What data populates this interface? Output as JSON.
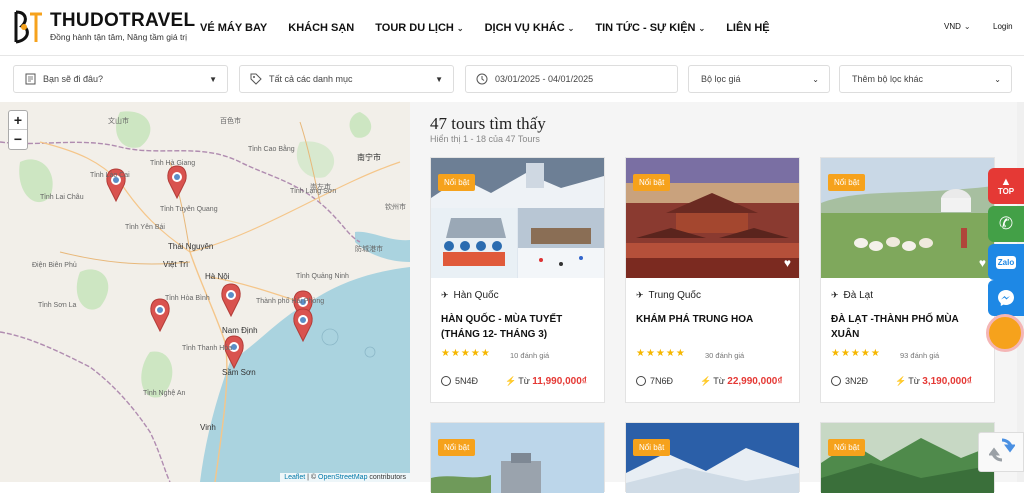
{
  "header": {
    "logo_name": "THUDOTRAVEL",
    "logo_slogan": "Đồng hành tận tâm, Nâng tầm giá trị",
    "nav": [
      {
        "label": "VÉ MÁY BAY",
        "dropdown": false
      },
      {
        "label": "KHÁCH SẠN",
        "dropdown": false
      },
      {
        "label": "TOUR DU LỊCH",
        "dropdown": true
      },
      {
        "label": "DỊCH VỤ KHÁC",
        "dropdown": true
      },
      {
        "label": "TIN TỨC - SỰ KIỆN",
        "dropdown": true
      },
      {
        "label": "LIÊN HỆ",
        "dropdown": false
      }
    ],
    "currency": "VND",
    "login": "Login"
  },
  "filters": {
    "destination_placeholder": "Bạn sẽ đi đâu?",
    "category_placeholder": "Tất cả các danh mục",
    "date_range": "03/01/2025 - 04/01/2025",
    "price_filter": "Bộ lọc giá",
    "more_filters": "Thêm bộ lọc khác"
  },
  "map": {
    "zoom_in": "+",
    "zoom_out": "−",
    "attribution_leaflet": "Leaflet",
    "attribution_sep": " | © ",
    "attribution_osm": "OpenStreetMap",
    "attribution_tail": " contributors",
    "labels": [
      "Tỉnh Hà Giang",
      "Tỉnh Lai Châu",
      "Tỉnh Tuyên Quang",
      "Thái Nguyên",
      "Việt Trì",
      "Hà Nội",
      "Tỉnh Hòa Bình",
      "Nam Định",
      "Thành phố Hải Phòng",
      "Tỉnh Thanh Hóa",
      "Sầm Sơn",
      "Tỉnh Nghệ An",
      "Vinh",
      "Điện Biên Phủ",
      "Tỉnh Sơn La",
      "Tỉnh Lào Cai",
      "Tỉnh Yên Bái",
      "Tỉnh Cao Bằng",
      "Tỉnh Lạng Sơn",
      "Tỉnh Quảng Ninh",
      "防城港市",
      "南宁市",
      "百色市",
      "文山市",
      "崇左市",
      "钦州市"
    ]
  },
  "results": {
    "title": "47 tours tìm thấy",
    "subtitle": "Hiển thị 1 - 18 của 47 Tours"
  },
  "tours": [
    {
      "badge": "Nổi bật",
      "destination": "Hàn Quốc",
      "name": "HÀN QUỐC - MÙA TUYẾT (THÁNG 12- THÁNG 3)",
      "rating": 5,
      "reviews": "10 đánh giá",
      "duration": "5N4Đ",
      "price_prefix": "Từ",
      "price": "11,990,000₫"
    },
    {
      "badge": "Nổi bật",
      "destination": "Trung Quốc",
      "name": "KHÁM PHÁ TRUNG HOA",
      "rating": 5,
      "reviews": "30 đánh giá",
      "duration": "7N6Đ",
      "price_prefix": "Từ",
      "price": "22,990,000₫"
    },
    {
      "badge": "Nổi bật",
      "destination": "Đà Lạt",
      "name": "ĐÀ LẠT -THÀNH PHỐ MÙA XUÂN",
      "rating": 5,
      "reviews": "93 đánh giá",
      "duration": "3N2Đ",
      "price_prefix": "Từ",
      "price": "3,190,000₫"
    },
    {
      "badge": "Nổi bật"
    },
    {
      "badge": "Nổi bật"
    },
    {
      "badge": "Nổi bật"
    }
  ],
  "floating": {
    "top_label": "TOP",
    "zalo_label": "Zalo"
  },
  "colors": {
    "accent_orange": "#f6a21c",
    "price_red": "#e53935",
    "star_yellow": "#f6b700",
    "marker_red": "#d9534f"
  }
}
